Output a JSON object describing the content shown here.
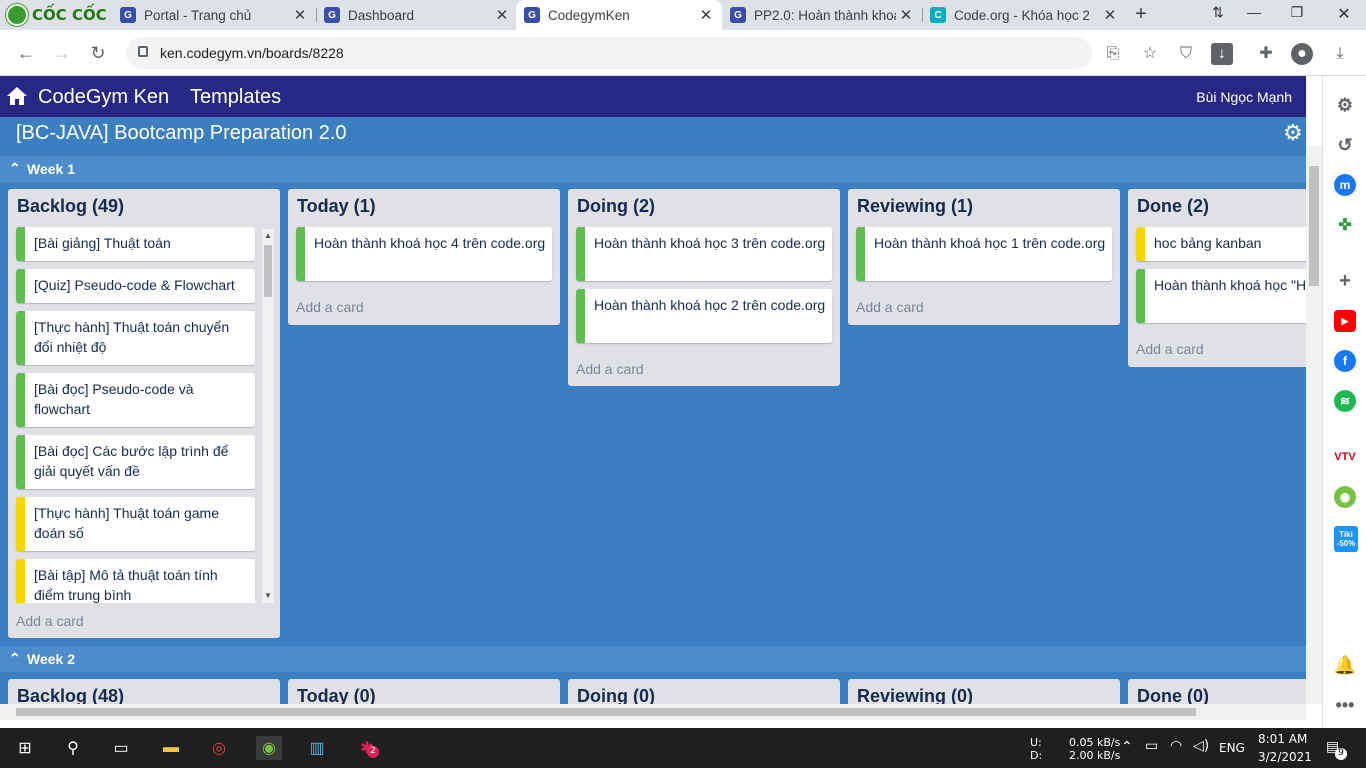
{
  "browser": {
    "brand": "CỐC CỐC",
    "tabs": [
      {
        "label": "Portal - Trang chủ",
        "favicon": "G"
      },
      {
        "label": "Dashboard",
        "favicon": "G"
      },
      {
        "label": "CodegymKen",
        "favicon": "G"
      },
      {
        "label": "PP2.0: Hoàn thành khoá",
        "favicon": "G"
      },
      {
        "label": "Code.org - Khóa học 2",
        "favicon": "C"
      }
    ],
    "address": "ken.codegym.vn/boards/8228"
  },
  "nav": {
    "brand": "CodeGym Ken",
    "templates": "Templates",
    "user": "Bùi Ngọc Mạnh"
  },
  "board": {
    "title": "[BC-JAVA] Bootcamp Preparation 2.0",
    "add_card_label": "Add a card",
    "weeks": [
      {
        "label": "Week 1",
        "lists": [
          {
            "title": "Backlog (49)",
            "cards": [
              {
                "text": "[Bài giảng] Thuật toán",
                "color": "#61bd4f"
              },
              {
                "text": "[Quiz] Pseudo-code & Flowchart",
                "color": "#61bd4f"
              },
              {
                "text": "[Thực hành] Thuật toán chuyển đổi nhiệt độ",
                "color": "#61bd4f"
              },
              {
                "text": "[Bài đọc] Pseudo-code và flowchart",
                "color": "#61bd4f"
              },
              {
                "text": "[Bài đọc] Các bước lập trình để giải quyết vấn đề",
                "color": "#61bd4f"
              },
              {
                "text": "[Thực hành] Thuật toán game đoán số",
                "color": "#f2d600"
              },
              {
                "text": "[Bài tập] Mô tả thuật toán tính điểm trung bình",
                "color": "#f2d600"
              }
            ]
          },
          {
            "title": "Today (1)",
            "cards": [
              {
                "text": "Hoàn thành khoá học 4 trên code.org",
                "color": "#61bd4f"
              }
            ]
          },
          {
            "title": "Doing (2)",
            "cards": [
              {
                "text": "Hoàn thành khoá học 3 trên code.org",
                "color": "#61bd4f"
              },
              {
                "text": "Hoàn thành khoá học 2 trên code.org",
                "color": "#61bd4f"
              }
            ]
          },
          {
            "title": "Reviewing (1)",
            "cards": [
              {
                "text": "Hoàn thành khoá học 1 trên code.org",
                "color": "#61bd4f"
              }
            ]
          },
          {
            "title": "Done (2)",
            "cards": [
              {
                "text": "hoc bảng kanban",
                "color": "#f2d600"
              },
              {
                "text": "Hoàn thành khoá học \"H học\"",
                "color": "#61bd4f"
              }
            ]
          }
        ]
      },
      {
        "label": "Week 2",
        "lists": [
          {
            "title": "Backlog (48)"
          },
          {
            "title": "Today (0)"
          },
          {
            "title": "Doing (0)"
          },
          {
            "title": "Reviewing (0)"
          },
          {
            "title": "Done (0)"
          }
        ]
      }
    ]
  },
  "taskbar": {
    "upload": "U:",
    "download": "D:",
    "up_rate": "0.05 kB/s",
    "down_rate": "2.00 kB/s",
    "lang": "ENG",
    "time": "8:01 AM",
    "date": "3/2/2021",
    "notif_count": "9",
    "slack_badge": "2"
  },
  "side_panel": {
    "tiki": "Tiki",
    "tiki_sale": "-50%",
    "vtv": "VTV"
  }
}
